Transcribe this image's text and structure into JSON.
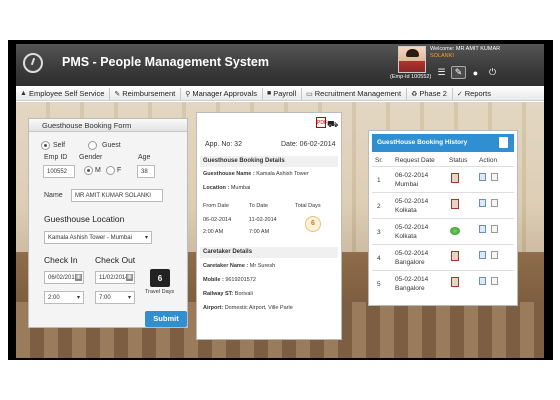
{
  "header": {
    "app_title": "PMS - People Management System",
    "welcome_line": "Welcome: MR AMIT KUMAR",
    "welcome_line2": "SOLANKI",
    "emp_id_label": "(Emp-Id 100552)",
    "icons": [
      "logo-icon",
      "menu-list-icon",
      "edit-icon",
      "user-icon",
      "power-icon"
    ]
  },
  "nav": {
    "items": [
      {
        "label": "Employee Self Service",
        "icon": "person-icon"
      },
      {
        "label": "Reimbursement",
        "icon": "wrench-icon"
      },
      {
        "label": "Manager Approvals",
        "icon": "search-icon"
      },
      {
        "label": "Payroll",
        "icon": "briefcase-icon"
      },
      {
        "label": "Recruitment Management",
        "icon": "monitor-icon"
      },
      {
        "label": "Phase 2",
        "icon": "recycle-icon"
      },
      {
        "label": "Reports",
        "icon": "thumbs-up-icon"
      }
    ]
  },
  "booking_form": {
    "title": "Guesthouse Booking Form",
    "radio_self": "Self",
    "radio_guest": "Guest",
    "emp_id_label": "Emp ID",
    "emp_id_value": "100552",
    "gender_label": "Gender",
    "gender_m": "M",
    "gender_f": "F",
    "age_label": "Age",
    "age_value": "38",
    "name_label": "Name",
    "name_value": "MR AMIT KUMAR  SOLANKI",
    "location_heading": "Guesthouse Location",
    "location_value": "Kamala Ashish Tower - Mumbai",
    "checkin_heading": "Check In",
    "checkout_heading": "Check Out",
    "checkin_date": "06/02/2014",
    "checkout_date": "11/02/2014",
    "checkin_time": "2:00",
    "checkout_time": "7:00",
    "travel_days_value": "6",
    "travel_days_label": "Travel Days",
    "submit_label": "Submit"
  },
  "details": {
    "app_no": "App. No: 32",
    "date": "Date: 06-02-2014",
    "gh_head": "Guesthouse Booking Details",
    "gh_name_label": "Guesthouse Name :",
    "gh_name_value": "Kamala Ashish Tower",
    "location_label": "Location :",
    "location_value": "Mumbai",
    "from_label": "From Date",
    "to_label": "To Date",
    "total_label": "Total Days",
    "from_date": "06-02-2014",
    "to_date": "11-02-2014",
    "from_time": "2:00 AM",
    "to_time": "7:00 AM",
    "total_days": "6",
    "ct_head": "Caretaker Details",
    "ct_name_label": "Caretaker Name :",
    "ct_name_value": "Mr Suresh",
    "mobile_label": "Mobile :",
    "mobile_value": "9619201572",
    "railway_label": "Railway ST:",
    "railway_value": "Borivali",
    "airport_label": "Airport:",
    "airport_value": "Domestic Airport, Ville Parle"
  },
  "history": {
    "title": "GuestHouse Booking History",
    "columns": [
      "Sr.",
      "Request Date",
      "Status",
      "Action"
    ],
    "rows": [
      {
        "sr": "1",
        "date": "06-02-2014",
        "city": "Mumbai",
        "status": "pending"
      },
      {
        "sr": "2",
        "date": "05-02-2014",
        "city": "Kolkata",
        "status": "pending"
      },
      {
        "sr": "3",
        "date": "05-02-2014",
        "city": "Kolkata",
        "status": "approved"
      },
      {
        "sr": "4",
        "date": "05-02-2014",
        "city": "Bangalore",
        "status": "pending"
      },
      {
        "sr": "5",
        "date": "05-02-2014",
        "city": "Bangalore",
        "status": "pending"
      }
    ]
  }
}
